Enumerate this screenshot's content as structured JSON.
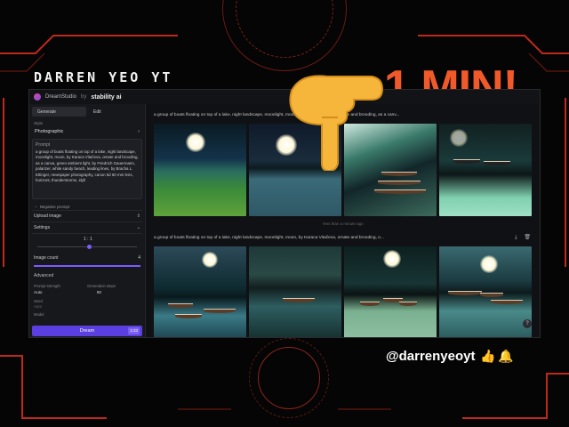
{
  "overlay": {
    "channel_title": "DARREN YEO YT",
    "headline": "1 MIN!",
    "handle": "@darrenyeoyt",
    "icons": [
      "pointing-hand-emoji",
      "thumbs-up-icon",
      "bell-icon"
    ],
    "accent_color": "#f05a2a",
    "decor_color": "#c0281a"
  },
  "app": {
    "brand": "DreamStudio",
    "by": "by",
    "partner": "stability ai",
    "tabs": [
      {
        "label": "Generate"
      },
      {
        "label": "Edit"
      }
    ],
    "style_label": "Style",
    "style_value": "Photographic",
    "prompt_label": "Prompt",
    "prompt_text": "a group of boats floating on top of a lake, night landscape, moonlight, moon, by Karaca Vitačeva, ornate and brooding, as a canva, green ambient light, by Friedrich Gauermann, polarizer, white sandy beach, leading lines, by Bracha L. Ettinger, newspaper photography, canon 5d 50 mm lens, horizont, thunderstorms, idyll",
    "negative_prompt": "Negative prompt",
    "upload_image": "Upload image",
    "settings": "Settings",
    "aspect_ratio": "1 : 1",
    "image_count_label": "Image count",
    "image_count": "4",
    "advanced": "Advanced",
    "prompt_strength_label": "Prompt strength",
    "prompt_strength": "Auto",
    "generation_steps_label": "Generation steps",
    "generation_steps": "50",
    "seed_label": "Seed",
    "seed_value": "Auto",
    "model_label": "Model",
    "dream_button": "Dream",
    "dream_cost": "3.33"
  },
  "generations": [
    {
      "prompt": "a group of boats floating on top of a lake, night landscape, moonlight, moon, by Karaca Vitačeva, ornate and brooding, as a canv...",
      "age": "less than a minute ago"
    },
    {
      "prompt": "a group of boats floating on top of a lake, night landscape, moonlight, moon, by Karaca Vitačeva, ornate and brooding, o..."
    }
  ]
}
